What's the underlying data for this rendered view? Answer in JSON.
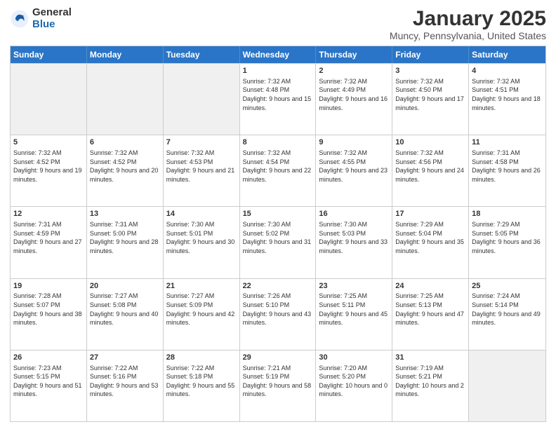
{
  "header": {
    "logo_general": "General",
    "logo_blue": "Blue",
    "month_title": "January 2025",
    "location": "Muncy, Pennsylvania, United States"
  },
  "calendar": {
    "days_of_week": [
      "Sunday",
      "Monday",
      "Tuesday",
      "Wednesday",
      "Thursday",
      "Friday",
      "Saturday"
    ],
    "weeks": [
      [
        {
          "day": "",
          "empty": true
        },
        {
          "day": "",
          "empty": true
        },
        {
          "day": "",
          "empty": true
        },
        {
          "day": "1",
          "sunrise": "7:32 AM",
          "sunset": "4:48 PM",
          "daylight": "9 hours and 15 minutes."
        },
        {
          "day": "2",
          "sunrise": "7:32 AM",
          "sunset": "4:49 PM",
          "daylight": "9 hours and 16 minutes."
        },
        {
          "day": "3",
          "sunrise": "7:32 AM",
          "sunset": "4:50 PM",
          "daylight": "9 hours and 17 minutes."
        },
        {
          "day": "4",
          "sunrise": "7:32 AM",
          "sunset": "4:51 PM",
          "daylight": "9 hours and 18 minutes."
        }
      ],
      [
        {
          "day": "5",
          "sunrise": "7:32 AM",
          "sunset": "4:52 PM",
          "daylight": "9 hours and 19 minutes."
        },
        {
          "day": "6",
          "sunrise": "7:32 AM",
          "sunset": "4:52 PM",
          "daylight": "9 hours and 20 minutes."
        },
        {
          "day": "7",
          "sunrise": "7:32 AM",
          "sunset": "4:53 PM",
          "daylight": "9 hours and 21 minutes."
        },
        {
          "day": "8",
          "sunrise": "7:32 AM",
          "sunset": "4:54 PM",
          "daylight": "9 hours and 22 minutes."
        },
        {
          "day": "9",
          "sunrise": "7:32 AM",
          "sunset": "4:55 PM",
          "daylight": "9 hours and 23 minutes."
        },
        {
          "day": "10",
          "sunrise": "7:32 AM",
          "sunset": "4:56 PM",
          "daylight": "9 hours and 24 minutes."
        },
        {
          "day": "11",
          "sunrise": "7:31 AM",
          "sunset": "4:58 PM",
          "daylight": "9 hours and 26 minutes."
        }
      ],
      [
        {
          "day": "12",
          "sunrise": "7:31 AM",
          "sunset": "4:59 PM",
          "daylight": "9 hours and 27 minutes."
        },
        {
          "day": "13",
          "sunrise": "7:31 AM",
          "sunset": "5:00 PM",
          "daylight": "9 hours and 28 minutes."
        },
        {
          "day": "14",
          "sunrise": "7:30 AM",
          "sunset": "5:01 PM",
          "daylight": "9 hours and 30 minutes."
        },
        {
          "day": "15",
          "sunrise": "7:30 AM",
          "sunset": "5:02 PM",
          "daylight": "9 hours and 31 minutes."
        },
        {
          "day": "16",
          "sunrise": "7:30 AM",
          "sunset": "5:03 PM",
          "daylight": "9 hours and 33 minutes."
        },
        {
          "day": "17",
          "sunrise": "7:29 AM",
          "sunset": "5:04 PM",
          "daylight": "9 hours and 35 minutes."
        },
        {
          "day": "18",
          "sunrise": "7:29 AM",
          "sunset": "5:05 PM",
          "daylight": "9 hours and 36 minutes."
        }
      ],
      [
        {
          "day": "19",
          "sunrise": "7:28 AM",
          "sunset": "5:07 PM",
          "daylight": "9 hours and 38 minutes."
        },
        {
          "day": "20",
          "sunrise": "7:27 AM",
          "sunset": "5:08 PM",
          "daylight": "9 hours and 40 minutes."
        },
        {
          "day": "21",
          "sunrise": "7:27 AM",
          "sunset": "5:09 PM",
          "daylight": "9 hours and 42 minutes."
        },
        {
          "day": "22",
          "sunrise": "7:26 AM",
          "sunset": "5:10 PM",
          "daylight": "9 hours and 43 minutes."
        },
        {
          "day": "23",
          "sunrise": "7:25 AM",
          "sunset": "5:11 PM",
          "daylight": "9 hours and 45 minutes."
        },
        {
          "day": "24",
          "sunrise": "7:25 AM",
          "sunset": "5:13 PM",
          "daylight": "9 hours and 47 minutes."
        },
        {
          "day": "25",
          "sunrise": "7:24 AM",
          "sunset": "5:14 PM",
          "daylight": "9 hours and 49 minutes."
        }
      ],
      [
        {
          "day": "26",
          "sunrise": "7:23 AM",
          "sunset": "5:15 PM",
          "daylight": "9 hours and 51 minutes."
        },
        {
          "day": "27",
          "sunrise": "7:22 AM",
          "sunset": "5:16 PM",
          "daylight": "9 hours and 53 minutes."
        },
        {
          "day": "28",
          "sunrise": "7:22 AM",
          "sunset": "5:18 PM",
          "daylight": "9 hours and 55 minutes."
        },
        {
          "day": "29",
          "sunrise": "7:21 AM",
          "sunset": "5:19 PM",
          "daylight": "9 hours and 58 minutes."
        },
        {
          "day": "30",
          "sunrise": "7:20 AM",
          "sunset": "5:20 PM",
          "daylight": "10 hours and 0 minutes."
        },
        {
          "day": "31",
          "sunrise": "7:19 AM",
          "sunset": "5:21 PM",
          "daylight": "10 hours and 2 minutes."
        },
        {
          "day": "",
          "empty": true
        }
      ]
    ]
  }
}
